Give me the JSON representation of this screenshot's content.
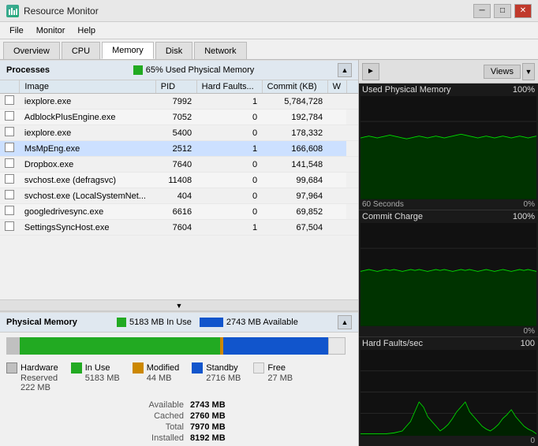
{
  "titleBar": {
    "icon": "📊",
    "title": "Resource Monitor",
    "minimizeLabel": "─",
    "maximizeLabel": "□",
    "closeLabel": "✕"
  },
  "menuBar": {
    "items": [
      "File",
      "Monitor",
      "Help"
    ]
  },
  "tabs": [
    {
      "label": "Overview",
      "active": false
    },
    {
      "label": "CPU",
      "active": false
    },
    {
      "label": "Memory",
      "active": true
    },
    {
      "label": "Disk",
      "active": false
    },
    {
      "label": "Network",
      "active": false
    }
  ],
  "processes": {
    "sectionTitle": "Processes",
    "statusLabel": "65% Used Physical Memory",
    "columns": [
      "Image",
      "PID",
      "Hard Faults...",
      "Commit (KB)",
      "W"
    ],
    "rows": [
      {
        "image": "iexplore.exe",
        "pid": "7992",
        "faults": "1",
        "commit": "5,784,728",
        "w": "",
        "highlighted": false
      },
      {
        "image": "AdblockPlusEngine.exe",
        "pid": "7052",
        "faults": "0",
        "commit": "192,784",
        "w": "",
        "highlighted": false
      },
      {
        "image": "iexplore.exe",
        "pid": "5400",
        "faults": "0",
        "commit": "178,332",
        "w": "",
        "highlighted": false
      },
      {
        "image": "MsMpEng.exe",
        "pid": "2512",
        "faults": "1",
        "commit": "166,608",
        "w": "",
        "highlighted": true
      },
      {
        "image": "Dropbox.exe",
        "pid": "7640",
        "faults": "0",
        "commit": "141,548",
        "w": "",
        "highlighted": false
      },
      {
        "image": "svchost.exe (defragsvc)",
        "pid": "11408",
        "faults": "0",
        "commit": "99,684",
        "w": "",
        "highlighted": false
      },
      {
        "image": "svchost.exe (LocalSystemNet...",
        "pid": "404",
        "faults": "0",
        "commit": "97,964",
        "w": "",
        "highlighted": false
      },
      {
        "image": "googledrivesync.exe",
        "pid": "6616",
        "faults": "0",
        "commit": "69,852",
        "w": "",
        "highlighted": false
      },
      {
        "image": "SettingsSyncHost.exe",
        "pid": "7604",
        "faults": "1",
        "commit": "67,504",
        "w": "",
        "highlighted": false
      }
    ]
  },
  "physicalMemory": {
    "sectionTitle": "Physical Memory",
    "inUseLabel": "5183 MB In Use",
    "availableLabel": "2743 MB Available",
    "barSegments": {
      "reserved": {
        "pct": 4,
        "color": "#c0c0c0"
      },
      "inuse": {
        "pct": 59,
        "color": "#22aa22"
      },
      "modified": {
        "pct": 1,
        "color": "#cc8800"
      },
      "standby": {
        "pct": 31,
        "color": "#1155cc"
      },
      "free": {
        "pct": 5,
        "color": "#e0e0e0"
      }
    },
    "legend": [
      {
        "label": "Hardware Reserved",
        "value": "222 MB",
        "color": "#c0c0c0"
      },
      {
        "label": "In Use",
        "value": "5183 MB",
        "color": "#22aa22"
      },
      {
        "label": "Modified",
        "value": "44 MB",
        "color": "#cc8800"
      },
      {
        "label": "Standby",
        "value": "2716 MB",
        "color": "#1155cc"
      },
      {
        "label": "Free",
        "value": "27 MB",
        "color": "#e8e8e8"
      }
    ],
    "details": [
      {
        "label": "Available",
        "value": "2743 MB"
      },
      {
        "label": "Cached",
        "value": "2760 MB"
      },
      {
        "label": "Total",
        "value": "7970 MB"
      },
      {
        "label": "Installed",
        "value": "8192 MB"
      }
    ]
  },
  "rightPanel": {
    "viewsLabel": "Views",
    "graphs": [
      {
        "title": "Used Physical Memory",
        "maxLabel": "100%",
        "timeLabel": "60 Seconds",
        "minLabel": "0%",
        "color": "#00cc00"
      },
      {
        "title": "Commit Charge",
        "maxLabel": "100%",
        "timeLabel": "",
        "minLabel": "0%",
        "color": "#00cc00"
      },
      {
        "title": "Hard Faults/sec",
        "maxLabel": "100",
        "timeLabel": "",
        "minLabel": "0",
        "color": "#00cc00"
      }
    ]
  }
}
